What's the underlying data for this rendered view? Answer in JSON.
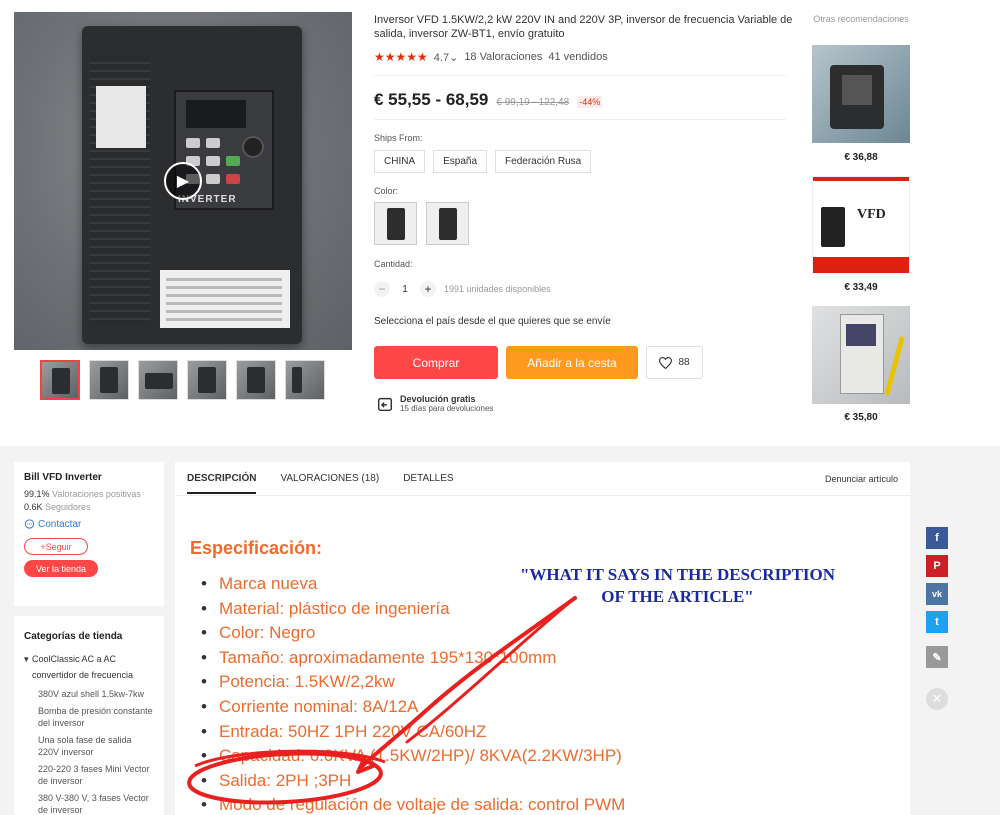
{
  "product": {
    "title": "Inversor VFD 1.5KW/2,2 kW 220V IN and 220V 3P, inversor de frecuencia Variable de salida, inversor ZW-BT1, envío gratuito",
    "rating_value": "4.7",
    "rating_stars": "★★★★★",
    "reviews": "18 Valoraciones",
    "sold": "41 vendidos",
    "price": "€ 55,55 - 68,59",
    "old_price": "€ 99,19 - 122,48",
    "discount": "-44%",
    "ships_from_label": "Ships From:",
    "ships_from": [
      "CHINA",
      "España",
      "Federación Rusa"
    ],
    "color_label": "Color:",
    "quantity_label": "Cantidad:",
    "quantity_value": "1",
    "quantity_minus": "−",
    "quantity_plus": "+",
    "quantity_available": "1991 unidades disponibles",
    "select_country": "Selecciona el país desde el que quieres que se envíe",
    "buy_label": "Comprar",
    "cart_label": "Añadir a la cesta",
    "wishlist_count": "88",
    "return_title": "Devolución gratis",
    "return_sub": "15 días para devoluciones",
    "video_inverter_text": "INVERTER"
  },
  "recommendations": {
    "title": "Otras recomendaciones",
    "items": [
      {
        "price": "€ 36,88"
      },
      {
        "price": "€ 33,49",
        "image_text": "VFD"
      },
      {
        "price": "€ 35,80"
      }
    ]
  },
  "seller": {
    "name": "Bill VFD Inverter",
    "positive_value": "99.1%",
    "positive_label": "Valoraciones positivas",
    "followers_value": "0.6K",
    "followers_label": "Seguidores",
    "contact": "Contactar",
    "follow": "+Seguir",
    "store": "Ver la tienda"
  },
  "categories": {
    "title": "Categorías de tienda",
    "main": "CoolClassic AC a AC convertidor de frecuencia",
    "items": [
      "380V azul shell 1.5kw-7kw",
      "Bomba de presión constante del inversor",
      "Una sola fase de salida 220V inversor",
      "220-220 3 fases Mini Vector de inversor",
      "380 V-380 V, 3 fases Vector de inversor"
    ]
  },
  "tabs": {
    "items": [
      "DESCRIPCIÓN",
      "VALORACIONES (18)",
      "DETALLES"
    ],
    "report": "Denunciar artículo"
  },
  "description": {
    "title": "Especificación:",
    "items": [
      "Marca nueva",
      "Material: plástico de ingeniería",
      "Color: Negro",
      "Tamaño: aproximadamente 195*130*100mm",
      "Potencia: 1.5KW/2,2kw",
      "Corriente nominal: 8A/12A",
      "Entrada: 50HZ 1PH 220V CA/60HZ",
      "Capacidad: 6.0KVA (1.5KW/2HP)/ 8KVA(2.2KW/3HP)",
      "Salida: 2PH ;3PH",
      "Modo de regulación de voltaje de salida: control PWM"
    ],
    "annotation_line1": "\"WHAT IT SAYS IN THE DESCRIPTION",
    "annotation_line2": "OF THE ARTICLE\""
  },
  "share": {
    "facebook": "f",
    "pinterest": "P",
    "vk": "vk",
    "twitter": "t",
    "edit": "✎",
    "close": "✕"
  },
  "colors": {
    "accent_red": "#ff4747",
    "accent_orange": "#ff9a1f",
    "spec_orange": "#ec6b2d",
    "annotation_blue": "#1a2a9c",
    "annotation_red_ink": "#e8201f"
  }
}
